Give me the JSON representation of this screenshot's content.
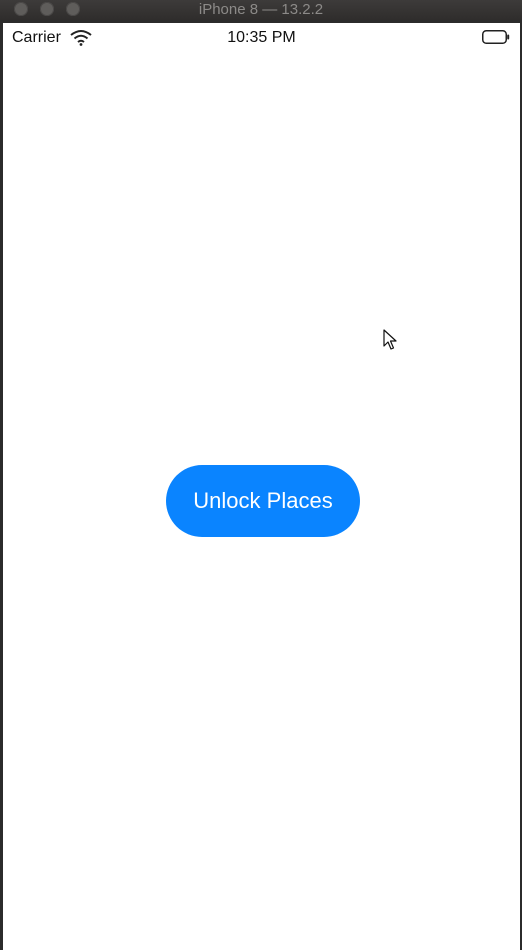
{
  "window": {
    "title": "iPhone 8 — 13.2.2"
  },
  "status_bar": {
    "carrier": "Carrier",
    "time": "10:35 PM",
    "icons": [
      "wifi-icon",
      "battery-icon"
    ]
  },
  "main": {
    "unlock_button_label": "Unlock Places"
  },
  "colors": {
    "accent": "#0a84ff",
    "screen_background": "#ffffff",
    "window_chrome": "#2f2d2c"
  }
}
